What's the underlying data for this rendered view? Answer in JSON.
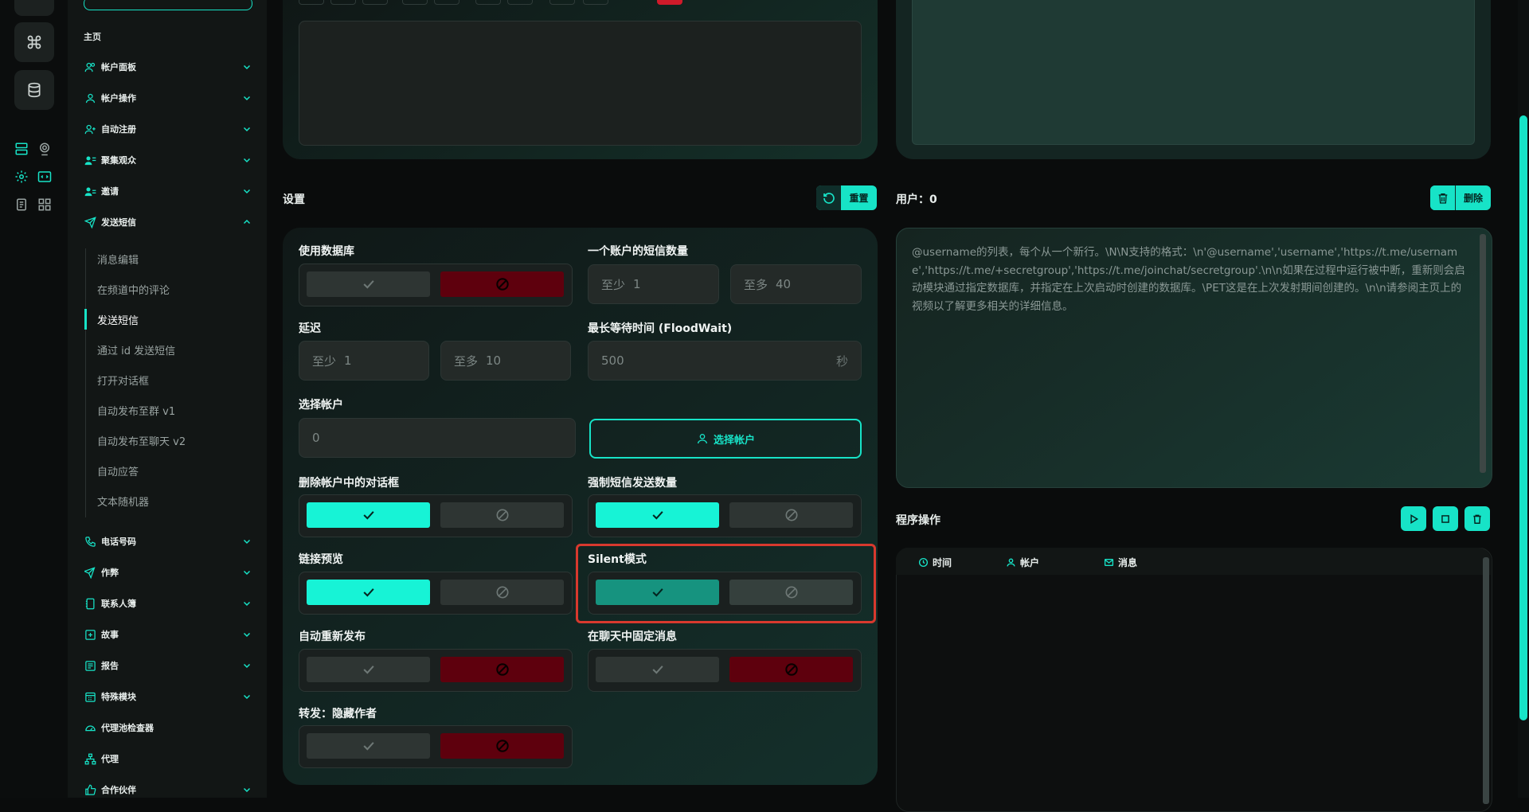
{
  "sidebar": {
    "section_title": "主页",
    "items": [
      {
        "label": "帐户面板"
      },
      {
        "label": "帐户操作"
      },
      {
        "label": "自动注册"
      },
      {
        "label": "聚集观众"
      },
      {
        "label": "邀请"
      },
      {
        "label": "发送短信"
      },
      {
        "label": "电话号码"
      },
      {
        "label": "作弊"
      },
      {
        "label": "联系人簿"
      },
      {
        "label": "故事"
      },
      {
        "label": "报告"
      },
      {
        "label": "特殊模块"
      },
      {
        "label": "代理池检查器"
      },
      {
        "label": "代理"
      },
      {
        "label": "合作伙伴"
      }
    ],
    "sub_items": [
      {
        "label": "消息编辑"
      },
      {
        "label": "在频道中的评论"
      },
      {
        "label": "发送短信"
      },
      {
        "label": "通过 id 发送短信"
      },
      {
        "label": "打开对话框"
      },
      {
        "label": "自动发布至群 v1"
      },
      {
        "label": "自动发布至聊天 v2"
      },
      {
        "label": "自动应答"
      },
      {
        "label": "文本随机器"
      }
    ]
  },
  "settings": {
    "title": "设置",
    "reset_label": "重置",
    "use_db_label": "使用数据库",
    "sms_per_account_label": "一个账户的短信数量",
    "sms_min_prefix": "至少",
    "sms_min_value": "1",
    "sms_max_prefix": "至多",
    "sms_max_value": "40",
    "delay_label": "延迟",
    "delay_min_prefix": "至少",
    "delay_min_value": "1",
    "delay_max_prefix": "至多",
    "delay_max_value": "10",
    "floodwait_label": "最长等待时间 (FloodWait)",
    "floodwait_value": "500",
    "floodwait_unit": "秒",
    "select_accounts_label": "选择帐户",
    "selected_accounts_value": "0",
    "select_accounts_button": "选择帐户",
    "delete_dialogs_label": "删除帐户中的对话框",
    "force_count_label": "强制短信发送数量",
    "link_preview_label": "链接预览",
    "silent_mode_label": "Silent模式",
    "auto_repost_label": "自动重新发布",
    "pin_message_label": "在聊天中固定消息",
    "forward_hide_label": "转发：隐藏作者"
  },
  "users": {
    "label": "用户：0",
    "delete_label": "删除",
    "placeholder": "@username的列表，每个从一个新行。\\N\\N支持的格式：\\n'@username','username','https://t.me/username','https://t.me/+secretgroup','https://t.me/joinchat/secretgroup'.\\n\\n如果在过程中运行被中断，重新则会启动模块通过指定数据库，并指定在上次启动时创建的数据库。\\PET这是在上次发射期间创建的。\\n\\n请参阅主页上的视频以了解更多相关的详细信息。"
  },
  "process": {
    "label": "程序操作",
    "columns": {
      "time": "时间",
      "account": "帐户",
      "message": "消息"
    }
  },
  "colors": {
    "accent": "#17e3c7",
    "danger": "#5e000d",
    "highlight": "#d8392e"
  }
}
